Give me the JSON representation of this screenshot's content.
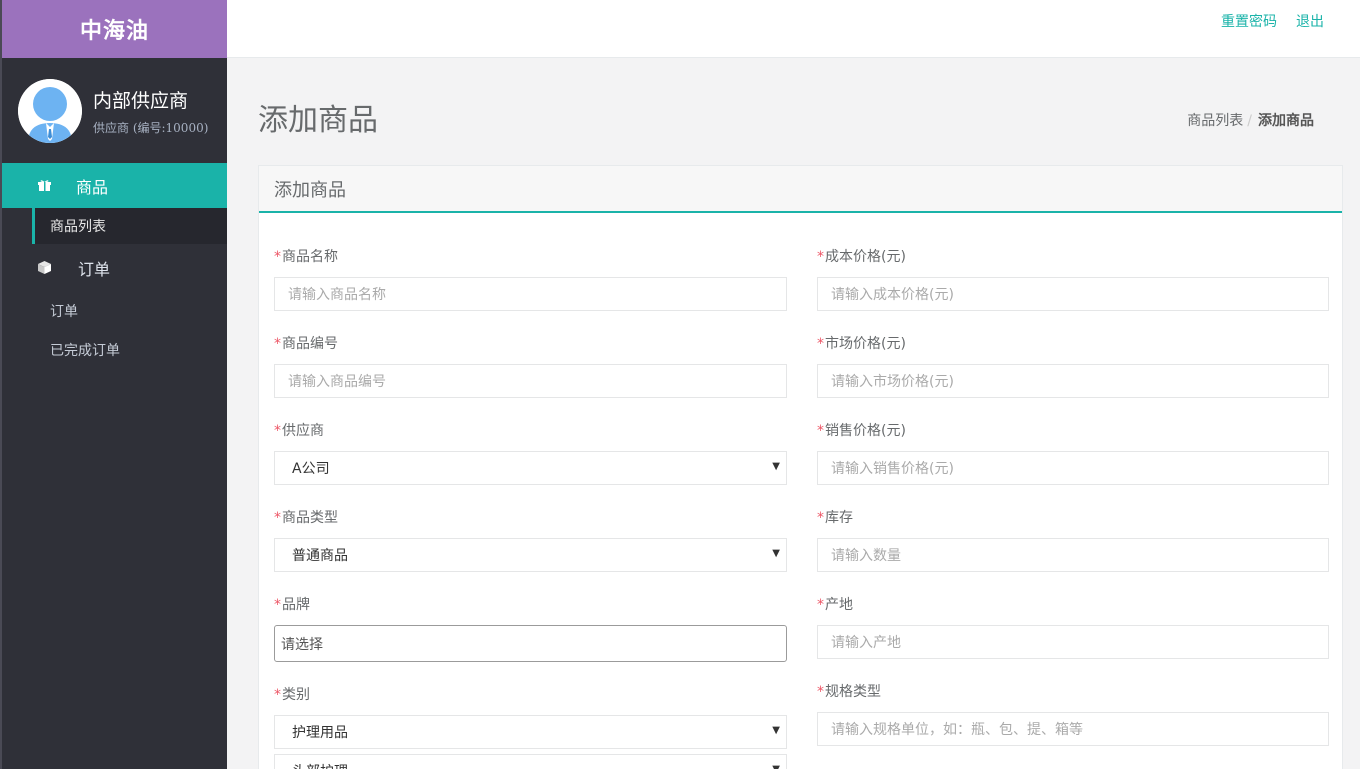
{
  "app": {
    "brand": "中海油"
  },
  "profile": {
    "name": "内部供应商",
    "sub": "供应商 (编号:10000)"
  },
  "nav": {
    "goods": {
      "label": "商品",
      "icon": "gift-icon"
    },
    "goods_list": {
      "label": "商品列表"
    },
    "orders": {
      "label": "订单",
      "icon": "box-icon"
    },
    "orders_sub": {
      "label": "订单"
    },
    "completed": {
      "label": "已完成订单"
    }
  },
  "topbar": {
    "reset_password": "重置密码",
    "logout": "退出"
  },
  "page": {
    "title": "添加商品"
  },
  "breadcrumb": {
    "parent": "商品列表",
    "sep": "/",
    "current": "添加商品"
  },
  "form": {
    "title": "添加商品",
    "required_mark": "*",
    "left": {
      "name": {
        "label": "商品名称",
        "placeholder": "请输入商品名称"
      },
      "code": {
        "label": "商品编号",
        "placeholder": "请输入商品编号"
      },
      "supplier": {
        "label": "供应商",
        "value": "A公司"
      },
      "type": {
        "label": "商品类型",
        "value": "普通商品"
      },
      "brand": {
        "label": "品牌",
        "placeholder": "请选择"
      },
      "category": {
        "label": "类别",
        "value": "护理用品",
        "sub_value": "头部护理"
      }
    },
    "right": {
      "cost": {
        "label": "成本价格(元)",
        "placeholder": "请输入成本价格(元)"
      },
      "market": {
        "label": "市场价格(元)",
        "placeholder": "请输入市场价格(元)"
      },
      "sale": {
        "label": "销售价格(元)",
        "placeholder": "请输入销售价格(元)"
      },
      "stock": {
        "label": "库存",
        "placeholder": "请输入数量"
      },
      "origin": {
        "label": "产地",
        "placeholder": "请输入产地"
      },
      "spec": {
        "label": "规格类型",
        "placeholder": "请输入规格单位，如：瓶、包、提、箱等"
      }
    },
    "arrow": "▼"
  }
}
